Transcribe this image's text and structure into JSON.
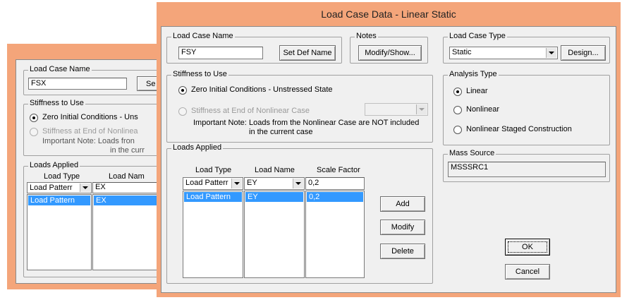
{
  "bg_dialog": {
    "load_case_name_legend": "Load Case Name",
    "load_case_name_value": "FSX",
    "set_def_btn_partial": "Se",
    "stiffness_legend": "Stiffness to Use",
    "zero_initial_partial": "Zero Initial Conditions - Uns",
    "stiffness_end_partial": "Stiffness at End of Nonlinea",
    "important_note_partial": "Important Note:  Loads fron",
    "important_note_partial2": "in the curr",
    "loads_applied_legend": "Loads Applied",
    "col_load_type": "Load Type",
    "col_load_name_partial": "Load Nam",
    "edit_load_type": "Load Patterr",
    "edit_load_name": "EX",
    "row_load_type": "Load Pattern",
    "row_load_name": "EX"
  },
  "main_dialog": {
    "title": "Load Case Data - Linear Static",
    "load_case_name_legend": "Load Case Name",
    "load_case_name_value": "FSY",
    "set_def_name_btn": "Set Def Name",
    "notes_legend": "Notes",
    "modify_show_btn": "Modify/Show...",
    "load_case_type_legend": "Load Case Type",
    "load_case_type_value": "Static",
    "design_btn": "Design...",
    "stiffness_legend": "Stiffness to Use",
    "zero_initial": "Zero Initial Conditions - Unstressed State",
    "stiffness_end": "Stiffness at End of Nonlinear Case",
    "important_note_label": "Important Note:",
    "important_note_line1": "Loads from the Nonlinear Case are NOT included",
    "important_note_line2": "in the current case",
    "analysis_type_legend": "Analysis Type",
    "analysis_linear": "Linear",
    "analysis_nonlinear": "Nonlinear",
    "analysis_staged": "Nonlinear Staged Construction",
    "loads_applied_legend": "Loads Applied",
    "col_load_type": "Load Type",
    "col_load_name": "Load Name",
    "col_scale_factor": "Scale Factor",
    "edit_load_type": "Load Patterr",
    "edit_load_name": "EY",
    "edit_scale_factor": "0,2",
    "row_load_type": "Load Pattern",
    "row_load_name": "EY",
    "row_scale_factor": "0,2",
    "add_btn": "Add",
    "modify_btn": "Modify",
    "delete_btn": "Delete",
    "mass_source_legend": "Mass Source",
    "mass_source_value": "MSSSRC1",
    "ok_btn": "OK",
    "cancel_btn": "Cancel"
  },
  "colors": {
    "frame": "#f4a57a",
    "selection": "#3399ff"
  }
}
